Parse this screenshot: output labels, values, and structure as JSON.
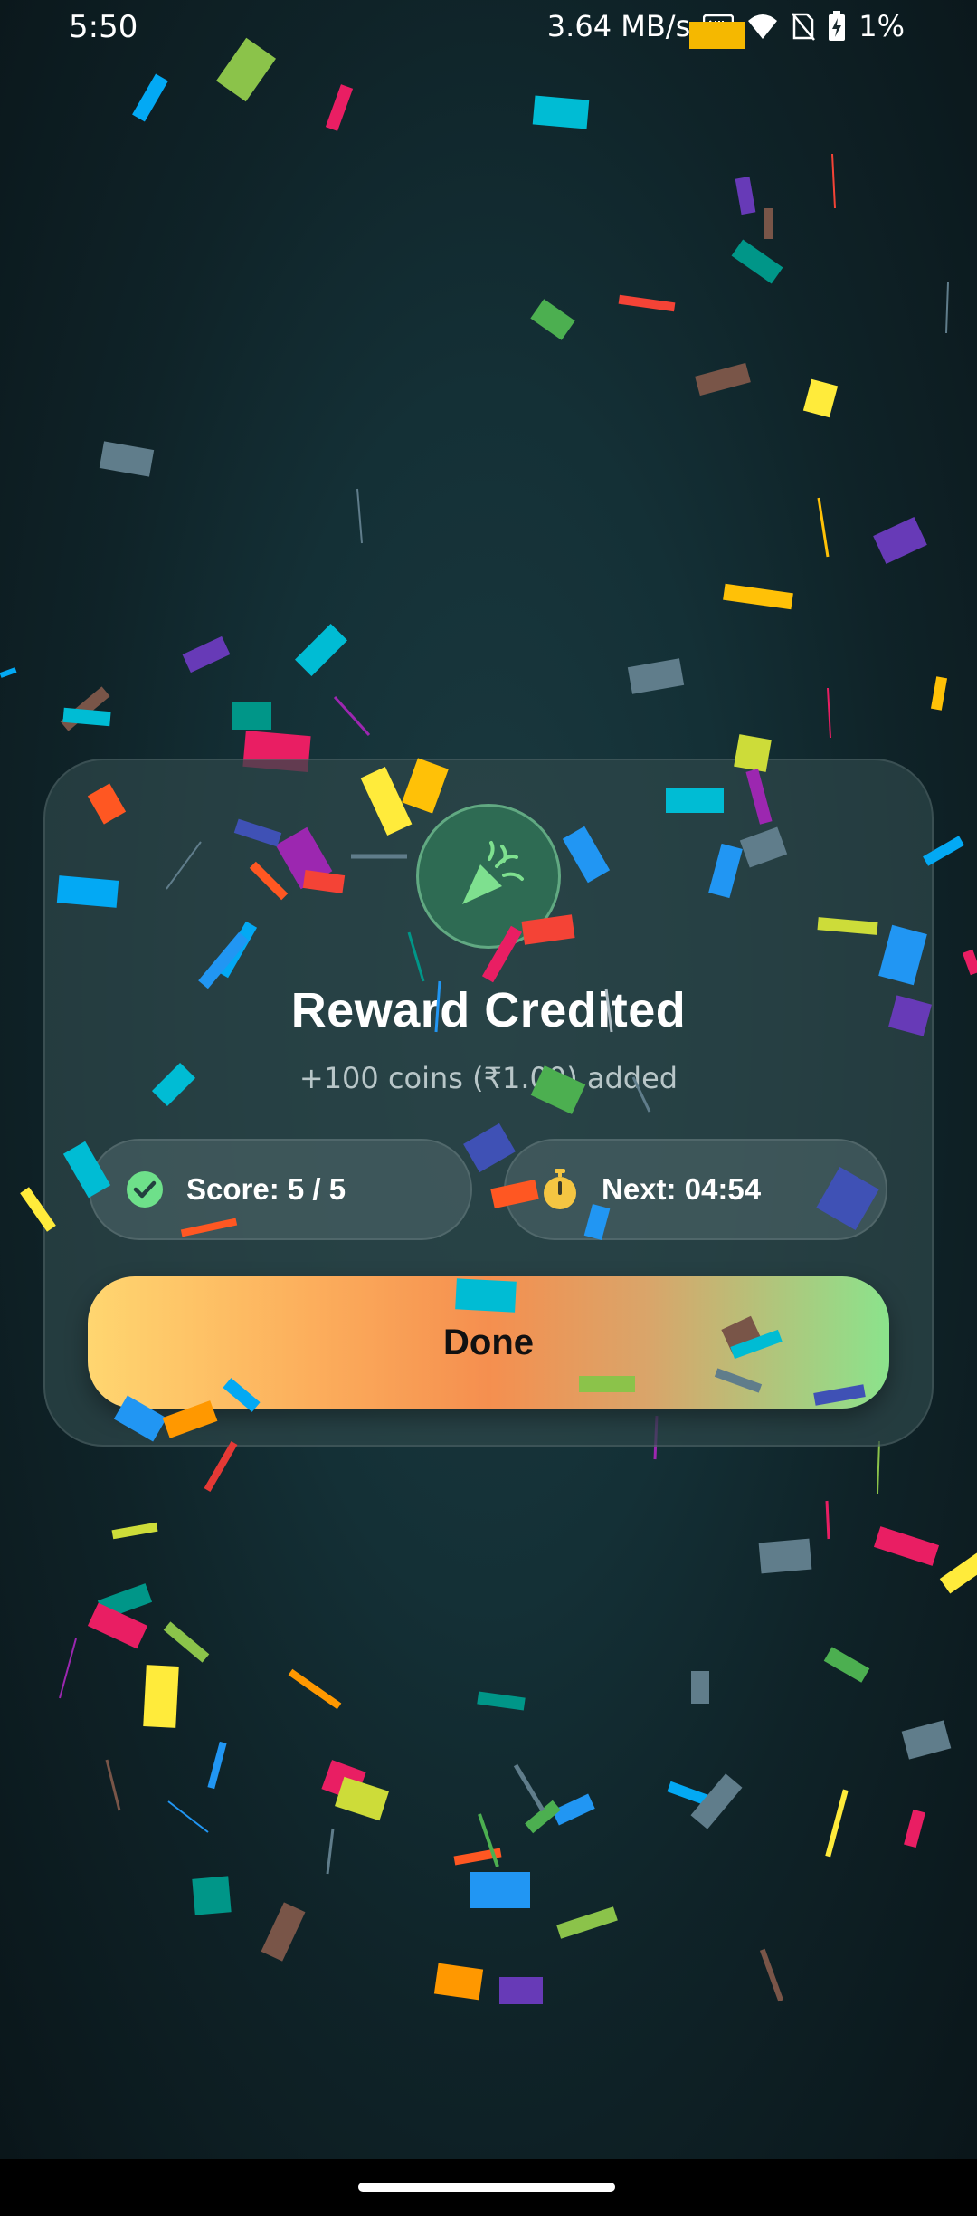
{
  "status_bar": {
    "time": "5:50",
    "network_speed": "3.64 MB/s",
    "battery_percent": "1%",
    "icons": [
      "nfc-icon",
      "wifi-icon",
      "sim-off-icon",
      "battery-charging-icon"
    ]
  },
  "card": {
    "icon": "party-popper-icon",
    "title": "Reward Credited",
    "subtitle": "+100 coins (₹1.00) added",
    "score_chip": {
      "icon": "check-circle-icon",
      "label": "Score: 5 / 5"
    },
    "next_chip": {
      "icon": "stopwatch-icon",
      "label": "Next: 04:54"
    },
    "done_label": "Done"
  },
  "colors": {
    "background": "#0f2328",
    "card_background": "#2e464a",
    "success_green": "#6ee08a",
    "timer_yellow": "#f5c542",
    "button_gradient_start": "#ffd670",
    "button_gradient_mid": "#f58f4f",
    "button_gradient_end": "#8be38c"
  }
}
